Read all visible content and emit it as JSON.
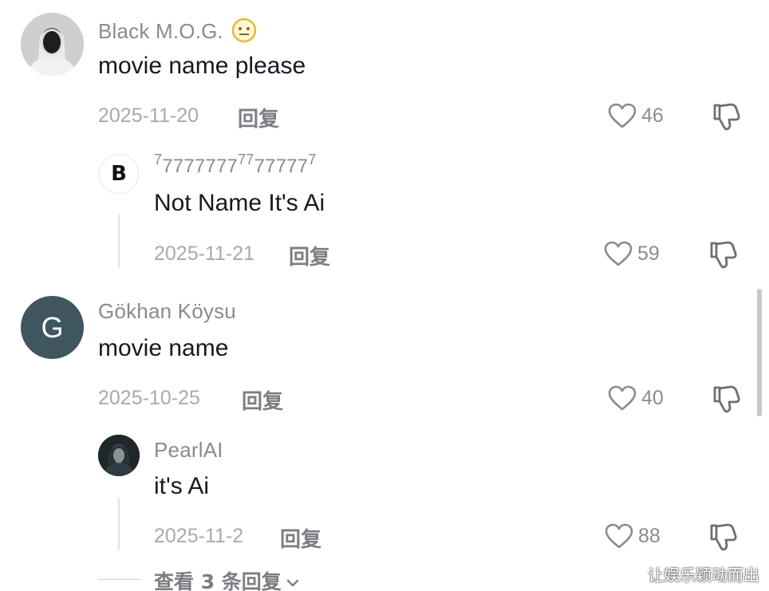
{
  "comments": [
    {
      "username": "Black M.O.G.",
      "text": "movie name please",
      "date": "2025-11-20",
      "reply_label": "回复",
      "likes": "46",
      "avatar_icon": "person-photo-avatar",
      "reply": {
        "username_parts": [
          "7",
          "7777777",
          "77",
          "77777",
          "7"
        ],
        "text": "Not Name It's Ai",
        "date": "2025-11-21",
        "reply_label": "回复",
        "likes": "59",
        "avatar_letter": "B"
      }
    },
    {
      "username": "Gökhan Köysu",
      "text": "movie name",
      "date": "2025-10-25",
      "reply_label": "回复",
      "likes": "40",
      "avatar_letter": "G",
      "avatar_color": "#3f5661",
      "reply": {
        "username": "PearlAI",
        "text": "it's Ai",
        "date": "2025-11-2",
        "reply_label": "回复",
        "likes": "88",
        "avatar_icon": "dark-portrait-avatar"
      }
    }
  ],
  "view_more": "查看 3 条回复",
  "watermark": "让娱乐颖动而出"
}
